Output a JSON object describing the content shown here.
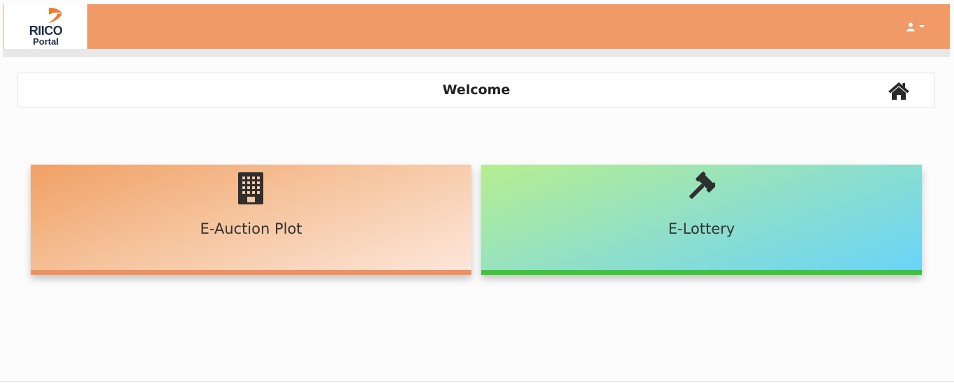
{
  "header": {
    "logo_text": "RIICO",
    "logo_subtext": "Portal",
    "user_icon": "user-icon",
    "dropdown_icon": "caret-down-icon",
    "bar_color": "#f09a67"
  },
  "welcome": {
    "title": "Welcome",
    "home_icon": "home-icon"
  },
  "cards": [
    {
      "label": "E-Auction Plot",
      "icon": "building-icon",
      "accent": "#ee9160"
    },
    {
      "label": "E-Lottery",
      "icon": "gavel-icon",
      "accent": "#3fc43a"
    }
  ]
}
